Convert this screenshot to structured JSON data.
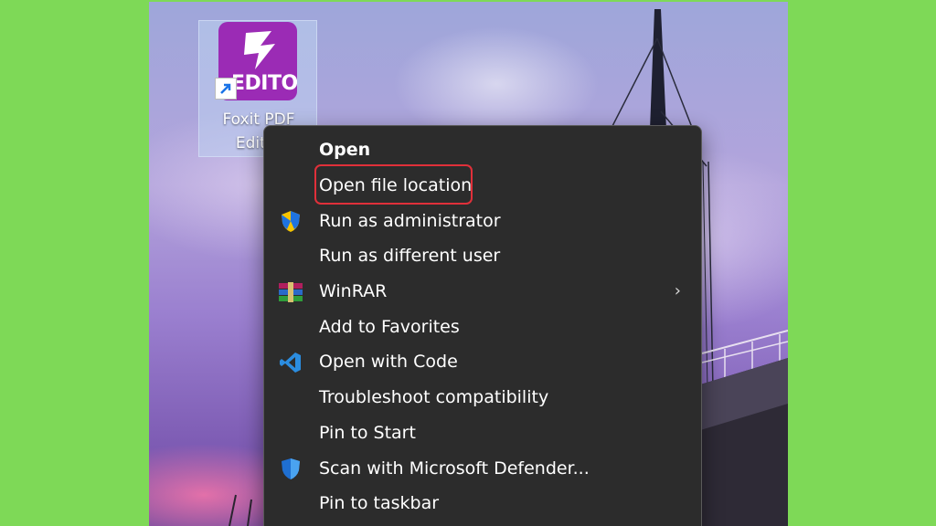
{
  "desktop": {
    "shortcut": {
      "logo_text": "EDITOR",
      "label": "Foxit PDF\nEditor"
    }
  },
  "context_menu": {
    "items": [
      {
        "label": "Open",
        "icon": "",
        "submenu": false
      },
      {
        "label": "Open file location",
        "icon": "",
        "submenu": false
      },
      {
        "label": "Run as administrator",
        "icon": "uac-shield-icon",
        "submenu": false
      },
      {
        "label": "Run as different user",
        "icon": "",
        "submenu": false
      },
      {
        "label": "WinRAR",
        "icon": "winrar-icon",
        "submenu": true
      },
      {
        "label": "Add to Favorites",
        "icon": "",
        "submenu": false
      },
      {
        "label": "Open with Code",
        "icon": "vscode-icon",
        "submenu": false
      },
      {
        "label": "Troubleshoot compatibility",
        "icon": "",
        "submenu": false
      },
      {
        "label": "Pin to Start",
        "icon": "",
        "submenu": false
      },
      {
        "label": "Scan with Microsoft Defender...",
        "icon": "defender-shield-icon",
        "submenu": false
      },
      {
        "label": "Pin to taskbar",
        "icon": "",
        "submenu": false
      }
    ],
    "submenu_glyph": "›",
    "highlighted_item": "Open file location"
  },
  "colors": {
    "page_background": "#7ed957",
    "menu_background": "#2c2c2c",
    "highlight_box": "#e0303a",
    "app_icon": "#9b2bb5"
  }
}
